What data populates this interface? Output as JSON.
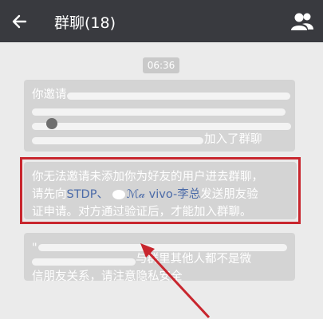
{
  "header": {
    "title": "群聊(18)",
    "back_icon": "back-arrow-icon",
    "members_icon": "group-members-icon"
  },
  "chat": {
    "timestamp": "06:36",
    "notice1": {
      "line1": "你邀请",
      "line4_suffix": "加入了群聊"
    },
    "notice2": {
      "line1": "你无法邀请未添加你为好友的用户进去群聊，",
      "line2_prefix": "请先向",
      "name1": "STDP、",
      "name2": "ℳ𝒶",
      "name3": "vivo-李总",
      "line2_suffix": "发送朋友验",
      "line3": "证申请。对方通过验证后，才能加入群聊。"
    },
    "notice3": {
      "line1_prefix": "\"",
      "line2_suffix": "与群里其他人都不是微",
      "line3": "信朋友关系，请注意隐私安全"
    }
  },
  "colors": {
    "titlebar": "#393a3f",
    "background": "#ebebeb",
    "notice_bg": "#d4d4d4",
    "highlight": "#4a6aa8",
    "annotation": "#c8262e"
  }
}
